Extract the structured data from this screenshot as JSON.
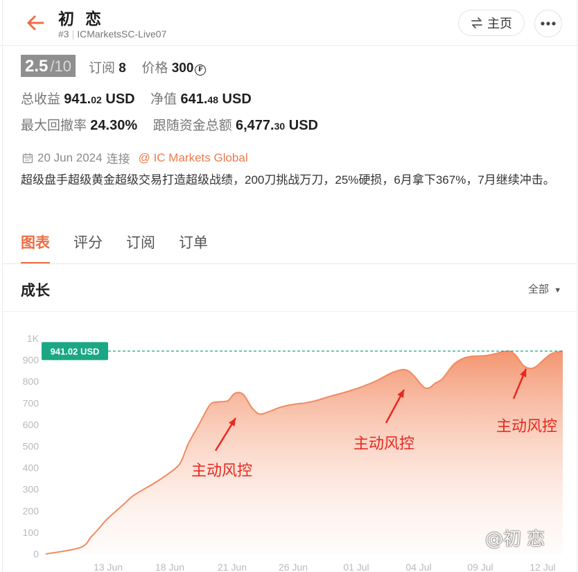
{
  "header": {
    "title": "初 恋",
    "rank": "#3",
    "account": "ICMarketsSC-Live07",
    "home_label": "主页"
  },
  "stats": {
    "rating": "2.5",
    "rating_max": "/10",
    "subs_label": "订阅",
    "subs_value": "8",
    "price_label": "价格",
    "price_value": "300",
    "profit_label": "总收益",
    "profit_int": "941.",
    "profit_dec": "02",
    "profit_cur": "USD",
    "equity_label": "净值",
    "equity_int": "641.",
    "equity_dec": "48",
    "equity_cur": "USD",
    "drawdown_label": "最大回撤率",
    "drawdown_value": "24.30%",
    "follow_label": "跟随资金总额",
    "follow_int": "6,477.",
    "follow_dec": "30",
    "follow_cur": "USD"
  },
  "connection": {
    "date": "20 Jun 2024",
    "label": "连接",
    "broker": "@ IC Markets Global"
  },
  "description": "超级盘手超级黄金超级交易打造超级战绩，200刀挑战万刀，25%硬损，6月拿下367%，7月继续冲击。",
  "tabs": [
    "图表",
    "评分",
    "订阅",
    "订单"
  ],
  "growth": {
    "title": "成长",
    "range_label": "全部"
  },
  "chart_data": {
    "type": "area",
    "current_label": "941.02 USD",
    "current_value": 941.02,
    "ylim": [
      0,
      1000
    ],
    "yticks": [
      "0",
      "100",
      "200",
      "300",
      "400",
      "500",
      "600",
      "700",
      "800",
      "900",
      "1K"
    ],
    "xticks": [
      "13 Jun",
      "18 Jun",
      "21 Jun",
      "26 Jun",
      "01 Jul",
      "04 Jul",
      "09 Jul",
      "12 Jul"
    ],
    "x": [
      0,
      2.9,
      3.8,
      4.4,
      5.1,
      6.5,
      7.3,
      8.2,
      9.4,
      10.9,
      11.4,
      11.9,
      12.8,
      13.7,
      14.3,
      15.2,
      15.8,
      16.5,
      17.2,
      17.8,
      18.4,
      19.1,
      19.6,
      20.3,
      21.1,
      21.6,
      22.5,
      23.7,
      25.0,
      26.4,
      27.7,
      28.9,
      30.0,
      30.7,
      31.3,
      31.7,
      32.1,
      32.5,
      33.1,
      33.6,
      34.1,
      34.8,
      35.4,
      36.1,
      36.8,
      37.5,
      38.2,
      38.8,
      39.3,
      39.9,
      40.5,
      41.0,
      41.4,
      41.9,
      42.3,
      43.2
    ],
    "values": [
      0,
      30,
      80,
      115,
      160,
      230,
      270,
      300,
      340,
      400,
      440,
      510,
      600,
      690,
      705,
      710,
      745,
      740,
      680,
      650,
      655,
      670,
      680,
      690,
      697,
      700,
      710,
      730,
      750,
      775,
      805,
      840,
      855,
      830,
      790,
      770,
      772,
      790,
      810,
      845,
      880,
      905,
      915,
      918,
      920,
      928,
      938,
      940,
      920,
      875,
      860,
      870,
      890,
      915,
      930,
      941
    ],
    "annotations": [
      "主动风控",
      "主动风控",
      "主动风控"
    ]
  },
  "watermark": "@初 恋",
  "colors": {
    "accent": "#ee6d43",
    "line": "#f08a5f",
    "badge": "#1ba784",
    "annotation": "#e8281f"
  }
}
